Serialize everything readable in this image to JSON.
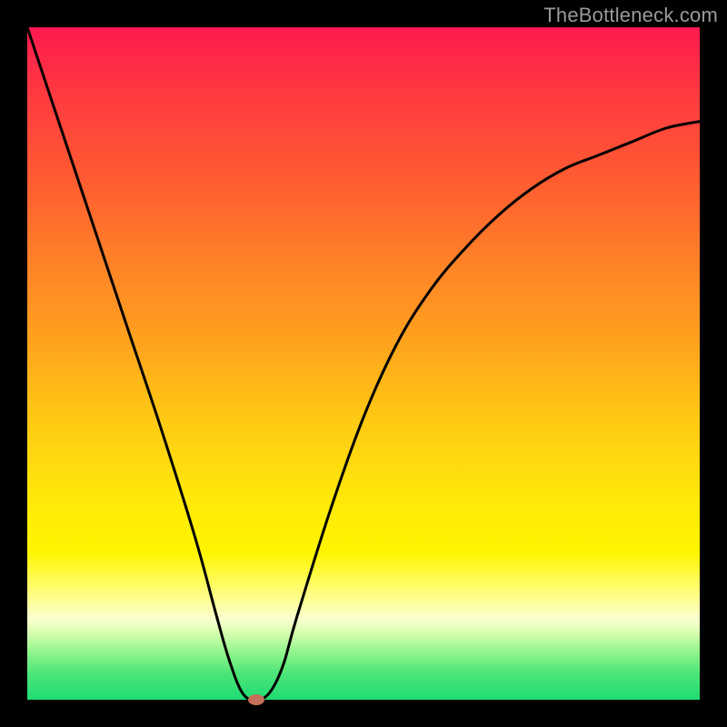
{
  "watermark": "TheBottleneck.com",
  "chart_data": {
    "type": "line",
    "title": "",
    "xlabel": "",
    "ylabel": "",
    "x_range": [
      0,
      100
    ],
    "y_range": [
      0,
      100
    ],
    "axes_visible": false,
    "grid": false,
    "background": "rainbow-gradient-red-to-green",
    "series": [
      {
        "name": "bottleneck-curve",
        "x": [
          0,
          5,
          10,
          15,
          20,
          25,
          28,
          30,
          32,
          34,
          36,
          38,
          40,
          45,
          50,
          55,
          60,
          65,
          70,
          75,
          80,
          85,
          90,
          95,
          100
        ],
        "y": [
          100,
          85,
          70,
          55,
          40,
          24,
          13,
          6,
          1,
          0,
          1,
          5,
          12,
          28,
          42,
          53,
          61,
          67,
          72,
          76,
          79,
          81,
          83,
          85,
          86
        ],
        "color": "#000000",
        "stroke_width": 3
      }
    ],
    "marker": {
      "name": "optimal-point",
      "x": 34,
      "y": 0,
      "color": "#c56e5a",
      "shape": "ellipse"
    }
  }
}
